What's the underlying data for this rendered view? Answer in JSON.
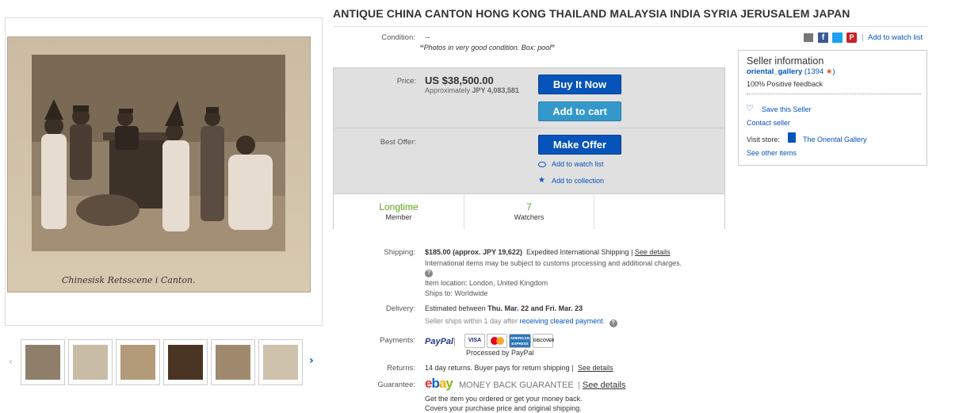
{
  "title": "ANTIQUE CHINA CANTON HONG KONG THAILAND MALAYSIA INDIA SYRIA JERUSALEM JAPAN",
  "photo_caption": "Chinesisk Retsscene i Canton.",
  "condition": {
    "label": "Condition:",
    "value": "--",
    "quote": "Photos in very good condition. Box: pool"
  },
  "share": {
    "add_to_watch": "Add to watch list"
  },
  "price": {
    "label": "Price:",
    "value": "US $38,500.00",
    "approx_prefix": "Approximately",
    "approx_value": "JPY 4,083,581"
  },
  "buttons": {
    "buy_now": "Buy It Now",
    "add_to_cart": "Add to cart",
    "make_offer": "Make Offer"
  },
  "best_offer": {
    "label": "Best Offer:",
    "add_to_watch": "Add to watch list",
    "add_to_collection": "Add to collection"
  },
  "stats": [
    {
      "big": "Longtime",
      "small": "Member"
    },
    {
      "big": "7",
      "small": "Watchers"
    }
  ],
  "shipping": {
    "label": "Shipping:",
    "cost": "$185.00",
    "approx": "(approx. JPY 19,622)",
    "service": "Expedited International Shipping |",
    "see_details": "See details",
    "customs": "International items may be subject to customs processing and additional charges.",
    "location": "Item location:  London, United Kingdom",
    "ships_to": "Ships to:  Worldwide"
  },
  "delivery": {
    "label": "Delivery:",
    "prefix": "Estimated between",
    "dates": "Thu. Mar. 22 and Fri. Mar. 23",
    "ships_within": "Seller ships within 1 day after",
    "cleared": "receiving cleared payment",
    "dot": "."
  },
  "payments": {
    "label": "Payments:",
    "paypal": "PayPal",
    "processed": "Processed by PayPal",
    "cards": [
      "VISA",
      "",
      "AMERICAN EXPRESS",
      "DISCOVER"
    ]
  },
  "returns": {
    "label": "Returns:",
    "text": "14 day returns. Buyer pays for return shipping |",
    "see_details": "See details"
  },
  "guarantee": {
    "label": "Guarantee:",
    "ebay": "ebay",
    "mbg": "MONEY BACK GUARANTEE",
    "see_details": "See details",
    "line1": "Get the item you ordered or get your money back.",
    "line2": "Covers your purchase price and original shipping."
  },
  "seller": {
    "heading": "Seller information",
    "name": "oriental_gallery",
    "score_open": "(",
    "score": "1394",
    "score_close": ")",
    "feedback": "100% Positive feedback",
    "save": "Save this Seller",
    "contact": "Contact seller",
    "visit_label": "Visit store:",
    "store": "The Oriental Gallery",
    "other": "See other items"
  },
  "colors": {
    "accent": "#0654ba",
    "secondary_button": "#3498ca",
    "stat_green": "#5ba71b",
    "star": "#e0541b",
    "panel_gray": "#e0e0e0"
  }
}
